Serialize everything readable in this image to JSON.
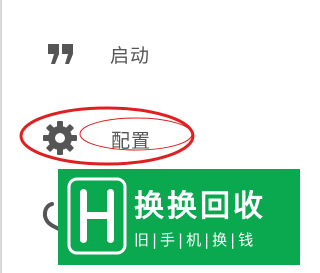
{
  "menu": {
    "items": [
      {
        "label": "启动",
        "icon": "quote-icon"
      },
      {
        "label": "配置",
        "icon": "gear-icon"
      },
      {
        "label": "",
        "icon": "partial-icon"
      }
    ]
  },
  "highlight": {
    "color": "#e02020"
  },
  "watermark": {
    "title": "换换回收",
    "subtitle": "旧|手|机|换|钱",
    "logo": "hui-logo",
    "background": "#0aa84f"
  },
  "colors": {
    "icon": "#555555",
    "text": "#555555"
  }
}
